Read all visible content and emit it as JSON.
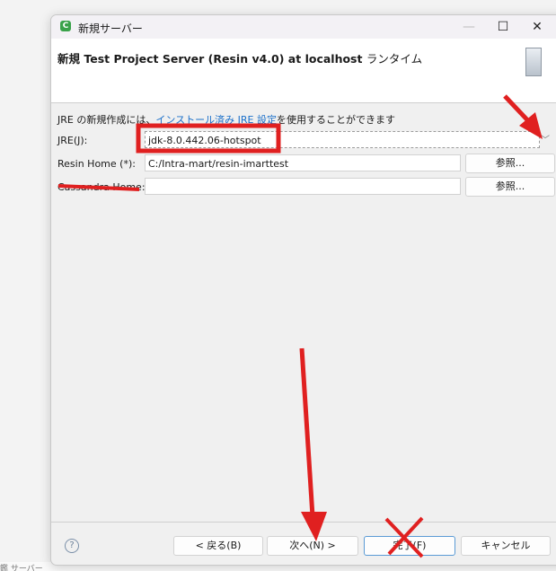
{
  "window": {
    "title": "新規サーバー",
    "icon": "eclipse-app-icon"
  },
  "header": {
    "title": "新規 Test Project Server (Resin v4.0) at localhost",
    "title_suffix": "ランタイム",
    "icon": "server-icon"
  },
  "info": {
    "prefix": "JRE の新規作成には、",
    "link": "インストール済み JRE 設定",
    "suffix": "を使用することができます"
  },
  "form": {
    "jre_label": "JRE(J):",
    "jre_value": "jdk-8.0.442.06-hotspot",
    "resin_home_label": "Resin Home (*):",
    "resin_home_value": "C:/Intra-mart/resin-imarttest",
    "cassandra_home_label": "Cassandra Home:",
    "cassandra_home_value": "",
    "browse_label": "参照..."
  },
  "buttons": {
    "back": "< 戻る(B)",
    "next": "次へ(N) >",
    "finish": "完了(F)",
    "cancel": "キャンセル"
  },
  "annotation_color": "#e02020",
  "background_text": "鑑 サーバー"
}
